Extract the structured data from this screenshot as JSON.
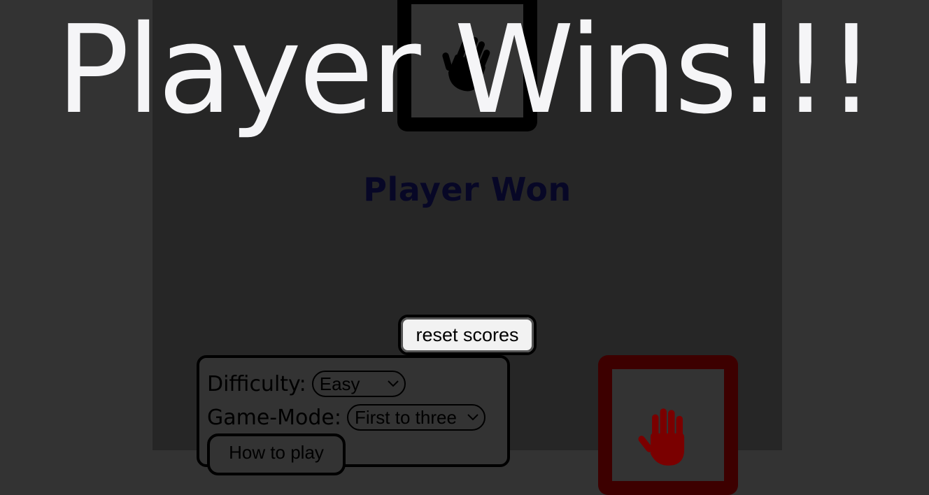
{
  "banner": {
    "text": "Player Wins!!!"
  },
  "round": {
    "result": "Player Won"
  },
  "buttons": {
    "reset": "reset scores",
    "how_to_play": "How to play"
  },
  "settings": {
    "difficulty_label": "Difficulty:",
    "difficulty_value": "Easy",
    "mode_label": "Game-Mode:",
    "mode_value": "First to three"
  },
  "cards": {
    "computer": {
      "choice_icon": "paper-hand-icon",
      "border_color": "#000000"
    },
    "player": {
      "choice_icon": "paper-hand-icon",
      "border_color": "#3d0000",
      "icon_color": "#7a0000"
    }
  },
  "colors": {
    "background": "#333333",
    "game_area": "#262626",
    "banner": "#f5f5f7",
    "result_text": "#070726"
  }
}
